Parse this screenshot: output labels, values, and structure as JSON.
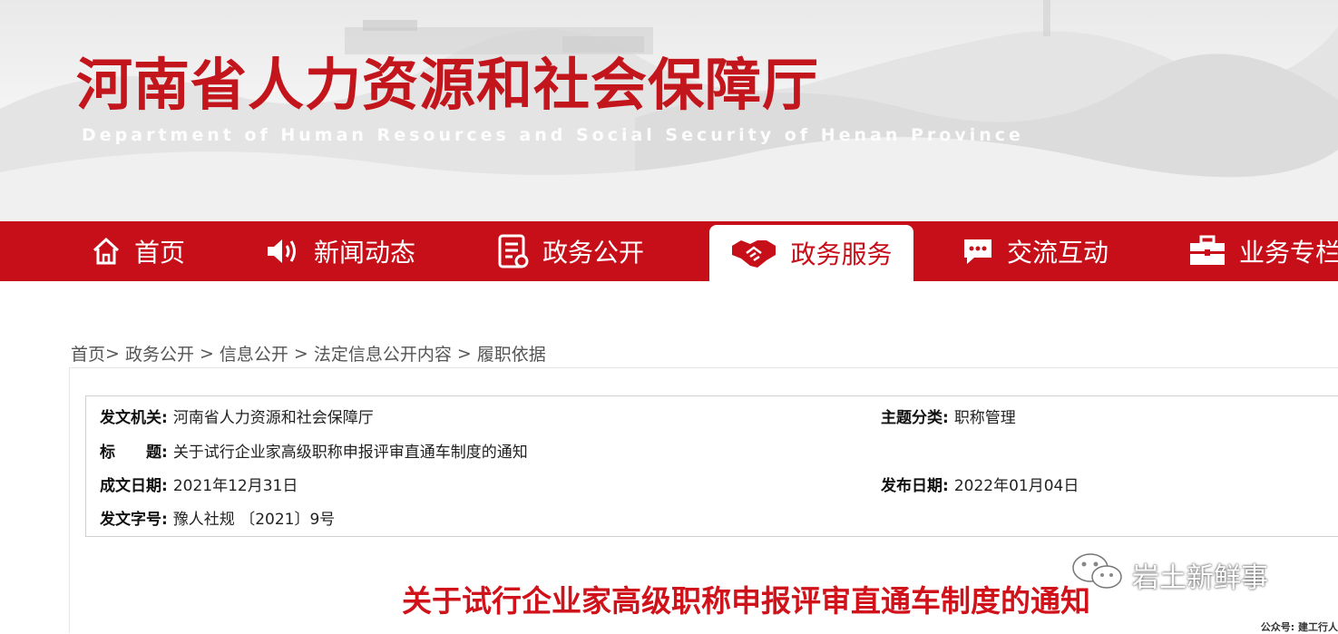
{
  "banner": {
    "title": "河南省人力资源和社会保障厅",
    "subtitle": "Department of Human Resources and Social Security of Henan Province"
  },
  "nav": {
    "items": [
      {
        "label": "首页",
        "icon": "home-icon"
      },
      {
        "label": "新闻动态",
        "icon": "speaker-icon"
      },
      {
        "label": "政务公开",
        "icon": "document-icon"
      },
      {
        "label": "政务服务",
        "icon": "handshake-icon",
        "active": true
      },
      {
        "label": "交流互动",
        "icon": "chat-icon"
      },
      {
        "label": "业务专栏",
        "icon": "briefcase-icon"
      }
    ]
  },
  "breadcrumb": {
    "items": [
      "首页",
      "政务公开",
      "信息公开",
      "法定信息公开内容",
      "履职依据"
    ],
    "separators": [
      ">",
      ">",
      ">",
      ">"
    ]
  },
  "meta": {
    "issuer_label": "发文机关:",
    "issuer": "河南省人力资源和社会保障厅",
    "topic_label": "主题分类:",
    "topic": "职称管理",
    "title_label": "标　　题:",
    "title": "关于试行企业家高级职称申报评审直通车制度的通知",
    "created_label": "成文日期:",
    "created": "2021年12月31日",
    "published_label": "发布日期:",
    "published": "2022年01月04日",
    "doc_no_label": "发文字号:",
    "doc_no": "豫人社规 〔2021〕9号"
  },
  "article": {
    "title": "关于试行企业家高级职称申报评审直通车制度的通知"
  },
  "watermark": {
    "text": "岩土新鲜事",
    "public_account": "公众号: 建工行人"
  },
  "colors": {
    "brand_red": "#c70f19",
    "title_red": "#d0121b"
  }
}
